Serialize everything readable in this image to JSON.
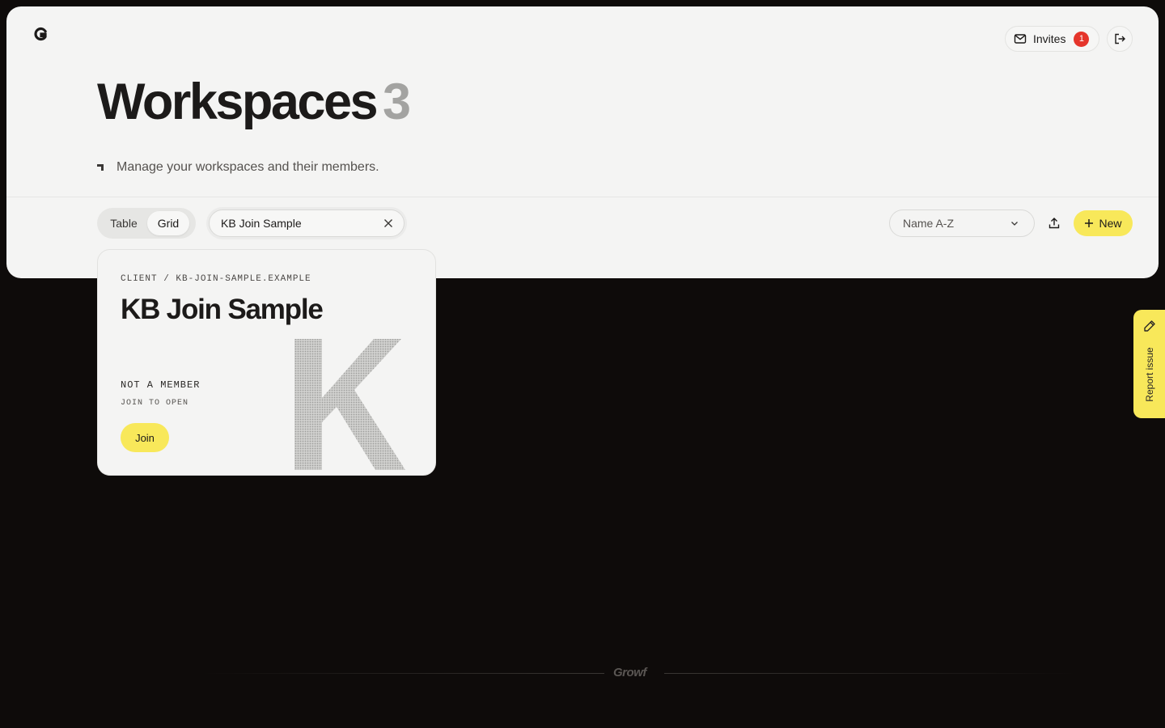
{
  "header": {
    "invites_label": "Invites",
    "invites_count": "1"
  },
  "page": {
    "title": "Workspaces",
    "count": "3",
    "subtitle": "Manage your workspaces and their members."
  },
  "toolbar": {
    "view_options": [
      "Table",
      "Grid"
    ],
    "active_view": "Grid",
    "search_value": "KB Join Sample",
    "sort_label": "Name A-Z",
    "new_label": "New"
  },
  "workspaces": [
    {
      "path": "CLIENT / KB-JOIN-SAMPLE.EXAMPLE",
      "name": "KB Join Sample",
      "status": "NOT A MEMBER",
      "hint": "JOIN TO OPEN",
      "action": "Join",
      "letter": "K"
    }
  ],
  "report": {
    "label": "Report issue"
  },
  "footer": {
    "brand": "Growf"
  },
  "colors": {
    "accent": "#f8e85a",
    "badge": "#e5352b",
    "panel": "#f4f4f3",
    "background": "#0e0b0a"
  }
}
